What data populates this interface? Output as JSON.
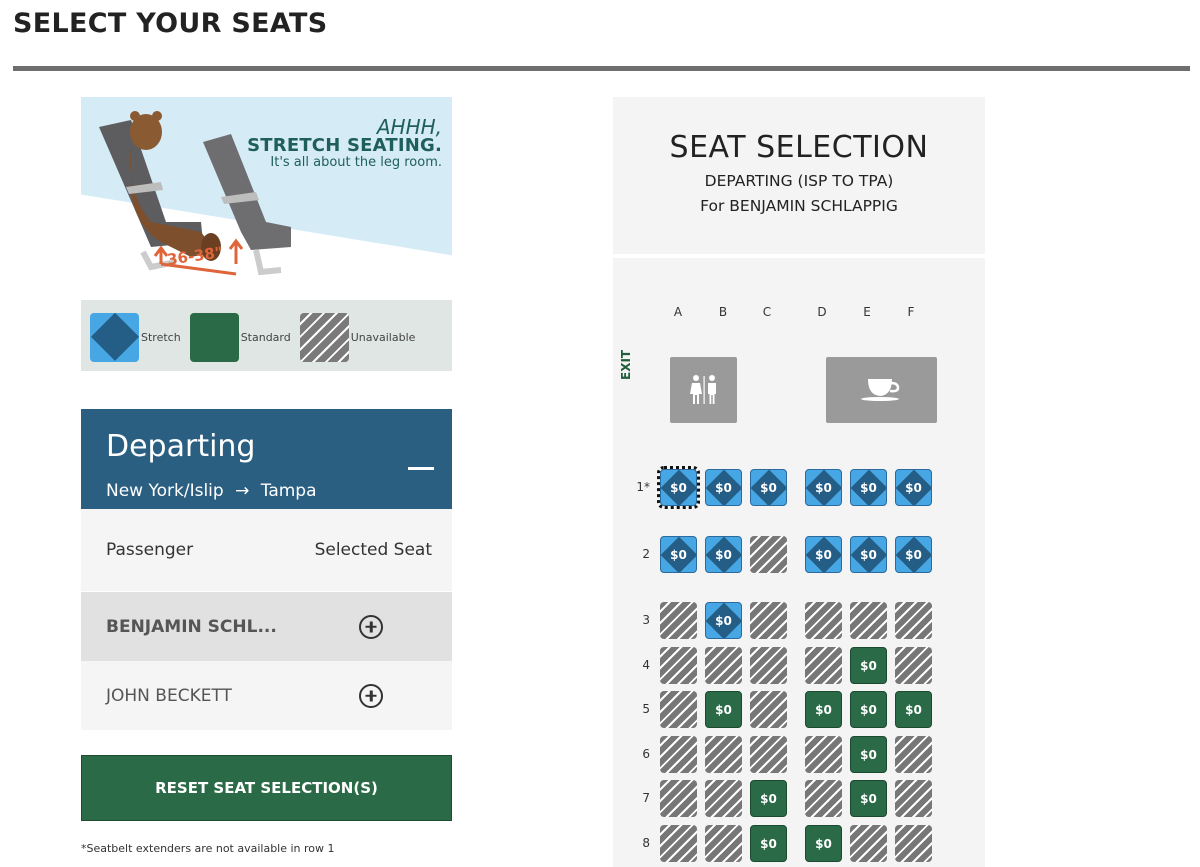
{
  "page": {
    "title": "SELECT YOUR SEATS"
  },
  "promo": {
    "line1": "AHHH,",
    "line2": "STRETCH SEATING.",
    "line3": "It's all about the leg room.",
    "legroom": "36-38\"",
    "legend": [
      {
        "type": "stretch",
        "label": "Stretch"
      },
      {
        "type": "standard",
        "label": "Standard"
      },
      {
        "type": "unavailable",
        "label": "Unavailable"
      }
    ]
  },
  "departing": {
    "title": "Departing",
    "origin": "New York/Islip",
    "arrow": "→",
    "destination": "Tampa",
    "collapse_icon": "minus-icon"
  },
  "passengers": {
    "header_left": "Passenger",
    "header_right": "Selected Seat",
    "list": [
      {
        "name": "BENJAMIN SCHL...",
        "active": true,
        "seat_icon": "add-circle-icon"
      },
      {
        "name": "JOHN BECKETT",
        "active": false,
        "seat_icon": "add-circle-icon"
      }
    ]
  },
  "reset_button": "RESET SEAT SELECTION(S)",
  "footnote": "*Seatbelt extenders are not available in row 1",
  "seat_selection": {
    "title": "SEAT SELECTION",
    "subtitle": "DEPARTING (ISP TO TPA)",
    "for_line": "For BENJAMIN SCHLAPPIG",
    "exit_label": "EXIT",
    "columns": [
      "A",
      "B",
      "C",
      "D",
      "E",
      "F"
    ],
    "amenities": [
      {
        "name": "lavatory",
        "icon": "restroom-icon"
      },
      {
        "name": "galley",
        "icon": "coffee-cup-icon"
      }
    ],
    "colors": {
      "stretch": "#47a6e4",
      "stretch_diamond": "#245d86",
      "standard": "#2b6a47",
      "unavailable": "#777777"
    },
    "rows": [
      {
        "label": "1*",
        "seats": [
          {
            "col": "A",
            "type": "stretch",
            "price": "$0",
            "focused": true
          },
          {
            "col": "B",
            "type": "stretch",
            "price": "$0"
          },
          {
            "col": "C",
            "type": "stretch",
            "price": "$0"
          },
          {
            "col": "D",
            "type": "stretch",
            "price": "$0"
          },
          {
            "col": "E",
            "type": "stretch",
            "price": "$0"
          },
          {
            "col": "F",
            "type": "stretch",
            "price": "$0"
          }
        ]
      },
      {
        "label": "2",
        "seats": [
          {
            "col": "A",
            "type": "stretch",
            "price": "$0"
          },
          {
            "col": "B",
            "type": "stretch",
            "price": "$0"
          },
          {
            "col": "C",
            "type": "unavailable",
            "price": ""
          },
          {
            "col": "D",
            "type": "stretch",
            "price": "$0"
          },
          {
            "col": "E",
            "type": "stretch",
            "price": "$0"
          },
          {
            "col": "F",
            "type": "stretch",
            "price": "$0"
          }
        ]
      },
      {
        "label": "3",
        "seats": [
          {
            "col": "A",
            "type": "unavailable",
            "price": ""
          },
          {
            "col": "B",
            "type": "stretch",
            "price": "$0"
          },
          {
            "col": "C",
            "type": "unavailable",
            "price": ""
          },
          {
            "col": "D",
            "type": "unavailable",
            "price": ""
          },
          {
            "col": "E",
            "type": "unavailable",
            "price": ""
          },
          {
            "col": "F",
            "type": "unavailable",
            "price": ""
          }
        ]
      },
      {
        "label": "4",
        "seats": [
          {
            "col": "A",
            "type": "unavailable",
            "price": ""
          },
          {
            "col": "B",
            "type": "unavailable",
            "price": ""
          },
          {
            "col": "C",
            "type": "unavailable",
            "price": ""
          },
          {
            "col": "D",
            "type": "unavailable",
            "price": ""
          },
          {
            "col": "E",
            "type": "standard",
            "price": "$0"
          },
          {
            "col": "F",
            "type": "unavailable",
            "price": ""
          }
        ]
      },
      {
        "label": "5",
        "seats": [
          {
            "col": "A",
            "type": "unavailable",
            "price": ""
          },
          {
            "col": "B",
            "type": "standard",
            "price": "$0"
          },
          {
            "col": "C",
            "type": "unavailable",
            "price": ""
          },
          {
            "col": "D",
            "type": "standard",
            "price": "$0"
          },
          {
            "col": "E",
            "type": "standard",
            "price": "$0"
          },
          {
            "col": "F",
            "type": "standard",
            "price": "$0"
          }
        ]
      },
      {
        "label": "6",
        "seats": [
          {
            "col": "A",
            "type": "unavailable",
            "price": ""
          },
          {
            "col": "B",
            "type": "unavailable",
            "price": ""
          },
          {
            "col": "C",
            "type": "unavailable",
            "price": ""
          },
          {
            "col": "D",
            "type": "unavailable",
            "price": ""
          },
          {
            "col": "E",
            "type": "standard",
            "price": "$0"
          },
          {
            "col": "F",
            "type": "unavailable",
            "price": ""
          }
        ]
      },
      {
        "label": "7",
        "seats": [
          {
            "col": "A",
            "type": "unavailable",
            "price": ""
          },
          {
            "col": "B",
            "type": "unavailable",
            "price": ""
          },
          {
            "col": "C",
            "type": "standard",
            "price": "$0"
          },
          {
            "col": "D",
            "type": "unavailable",
            "price": ""
          },
          {
            "col": "E",
            "type": "standard",
            "price": "$0"
          },
          {
            "col": "F",
            "type": "unavailable",
            "price": ""
          }
        ]
      },
      {
        "label": "8",
        "seats": [
          {
            "col": "A",
            "type": "unavailable",
            "price": ""
          },
          {
            "col": "B",
            "type": "unavailable",
            "price": ""
          },
          {
            "col": "C",
            "type": "standard",
            "price": "$0"
          },
          {
            "col": "D",
            "type": "standard",
            "price": "$0"
          },
          {
            "col": "E",
            "type": "unavailable",
            "price": ""
          },
          {
            "col": "F",
            "type": "unavailable",
            "price": ""
          }
        ]
      }
    ]
  }
}
